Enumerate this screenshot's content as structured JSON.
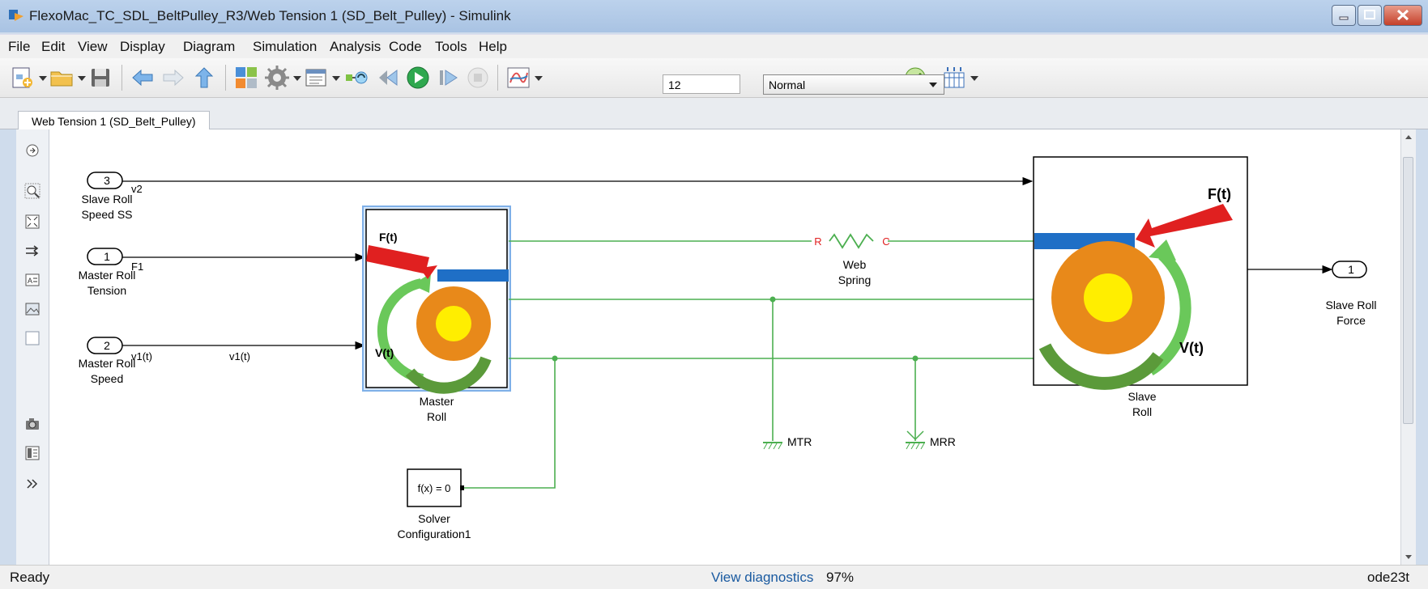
{
  "window": {
    "title": "FlexoMac_TC_SDL_BeltPulley_R3/Web Tension 1 (SD_Belt_Pulley) - Simulink"
  },
  "menu": [
    "File",
    "Edit",
    "View",
    "Display",
    "Diagram",
    "Simulation",
    "Analysis",
    "Code",
    "Tools",
    "Help"
  ],
  "toolbar": {
    "stop_time": "12",
    "sim_mode": "Normal"
  },
  "tab": {
    "label": "Web Tension 1 (SD_Belt_Pulley)"
  },
  "diagram": {
    "inport3": {
      "number": "3",
      "label1": "Slave Roll",
      "label2": "Speed SS",
      "signal": "v2"
    },
    "inport1": {
      "number": "1",
      "label1": "Master Roll",
      "label2": "Tension",
      "signal": "F1"
    },
    "inport2": {
      "number": "2",
      "label1": "Master Roll",
      "label2": "Speed",
      "signal": "v1(t)",
      "line_label": "v1(t)"
    },
    "master_roll": {
      "name1": "Master",
      "name2": "Roll",
      "force": "F(t)",
      "velocity": "V(t)"
    },
    "slave_roll": {
      "name1": "Slave",
      "name2": "Roll",
      "force": "F(t)",
      "velocity": "V(t)"
    },
    "spring": {
      "port_r": "R",
      "port_c": "C",
      "name1": "Web",
      "name2": "Spring"
    },
    "mtr": {
      "label": "MTR"
    },
    "mrr": {
      "label": "MRR"
    },
    "solver": {
      "expr": "f(x) = 0",
      "name1": "Solver",
      "name2": "Configuration1"
    },
    "outport": {
      "number": "1",
      "label1": "Slave Roll",
      "label2": "Force"
    }
  },
  "status": {
    "left": "Ready",
    "center": "View diagnostics",
    "zoom": "97%",
    "solver": "ode23t"
  },
  "colors": {
    "signal_line": "#000000",
    "physical_line": "#4caf50",
    "force_arrow": "#e02020",
    "roll_orange": "#e8891a",
    "roll_core": "#ffee00",
    "belt_bar": "#1f6fc6"
  }
}
